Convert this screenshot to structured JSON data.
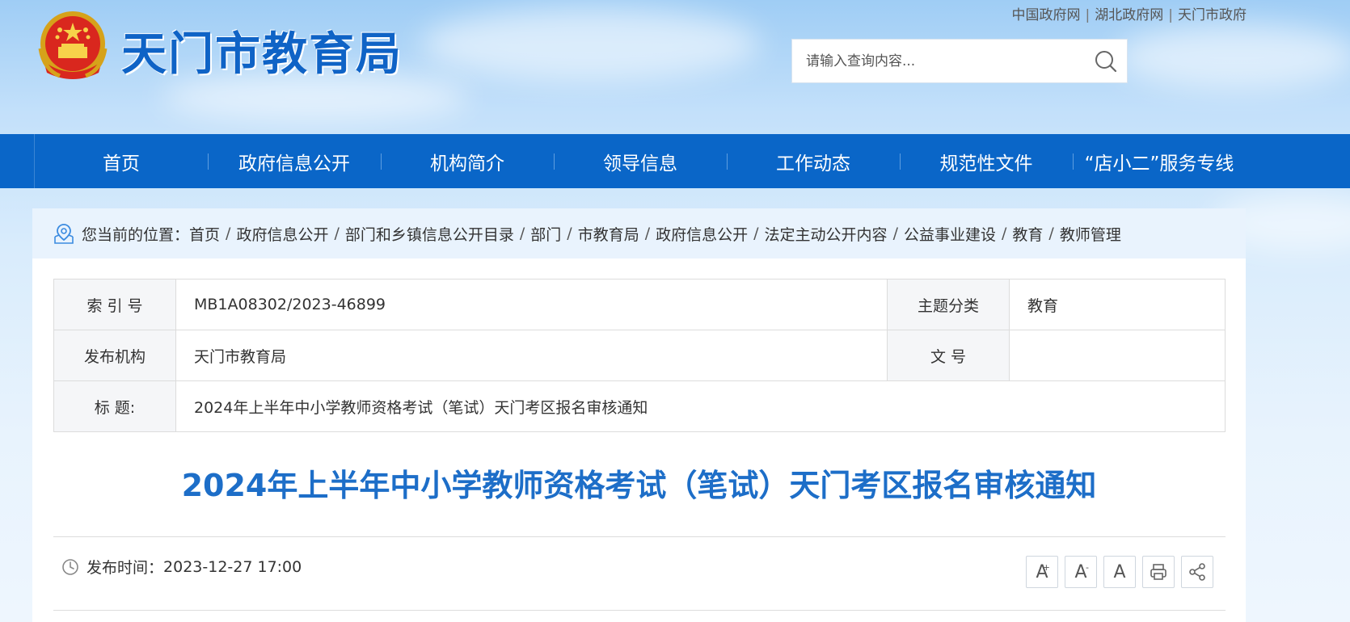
{
  "header": {
    "site_name": "天门市教育局",
    "top_links": [
      "中国政府网",
      "湖北政府网",
      "天门市政府"
    ],
    "search": {
      "placeholder": "请输入查询内容..."
    }
  },
  "nav": {
    "items": [
      "首页",
      "政府信息公开",
      "机构简介",
      "领导信息",
      "工作动态",
      "规范性文件",
      "“店小二”服务专线"
    ]
  },
  "breadcrumb": {
    "label": "您当前的位置：",
    "items": [
      "首页",
      "政府信息公开",
      "部门和乡镇信息公开目录",
      "部门",
      "市教育局",
      "政府信息公开",
      "法定主动公开内容",
      "公益事业建设",
      "教育",
      "教师管理"
    ]
  },
  "meta": {
    "index_label": "索 引 号",
    "index_value": "MB1A08302/2023-46899",
    "topic_label": "主题分类",
    "topic_value": "教育",
    "publisher_label": "发布机构",
    "publisher_value": "天门市教育局",
    "doc_no_label": "文 号",
    "doc_no_value": "",
    "title_label": "标 题:",
    "title_value": "2024年上半年中小学教师资格考试（笔试）天门考区报名审核通知"
  },
  "article": {
    "title": "2024年上半年中小学教师资格考试（笔试）天门考区报名审核通知",
    "publish_label": "发布时间：",
    "publish_time": "2023-12-27 17:00"
  },
  "tools": {
    "font_large": "A",
    "font_small": "A",
    "font_default": "A",
    "plus_mark": "+",
    "minus_mark": "-"
  },
  "colors": {
    "nav_bg": "#0a66c8",
    "title": "#1d6ec8",
    "site_name": "#0f63c6"
  }
}
